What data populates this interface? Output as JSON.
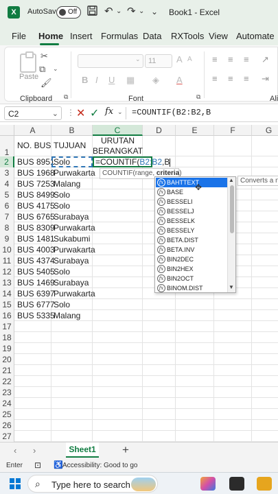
{
  "titlebar": {
    "autosave_label": "AutoSave",
    "autosave_state": "Off",
    "title": "Book1 - Excel"
  },
  "menu": {
    "tabs": [
      "File",
      "Home",
      "Insert",
      "Formulas",
      "Data",
      "RXTools",
      "View",
      "Automate"
    ],
    "active": "Home"
  },
  "ribbon": {
    "paste_label": "Paste",
    "font_size": "11",
    "groups": {
      "clipboard": "Clipboard",
      "font": "Font",
      "alignment": "Ali"
    }
  },
  "formula_bar": {
    "name_box": "C2",
    "content": "=COUNTIF(B2:B2,B"
  },
  "grid": {
    "columns": [
      "A",
      "B",
      "C",
      "D",
      "E",
      "F",
      "G"
    ],
    "selected_column": "C",
    "selected_row": 2,
    "rows": [
      "1",
      "2",
      "3",
      "4",
      "5",
      "6",
      "7",
      "8",
      "9",
      "10",
      "11",
      "12",
      "13",
      "14",
      "15",
      "16",
      "17",
      "18",
      "19",
      "20",
      "21",
      "22",
      "23",
      "24",
      "25",
      "26",
      "27"
    ],
    "header": {
      "a": "NO. BUS",
      "b": "TUJUAN",
      "c_line1": "URUTAN",
      "c_line2": "BERANGKAT"
    },
    "data": [
      [
        "BUS 8951",
        "Solo"
      ],
      [
        "BUS 1968",
        "Purwakarta"
      ],
      [
        "BUS 7253",
        "Malang"
      ],
      [
        "BUS 8499",
        "Solo"
      ],
      [
        "BUS 4175",
        "Solo"
      ],
      [
        "BUS 6765",
        "Surabaya"
      ],
      [
        "BUS 8309",
        "Purwakarta"
      ],
      [
        "BUS 1481",
        "Sukabumi"
      ],
      [
        "BUS 4003",
        "Purwakarta"
      ],
      [
        "BUS 4374",
        "Surabaya"
      ],
      [
        "BUS 5405",
        "Solo"
      ],
      [
        "BUS 1469",
        "Surabaya"
      ],
      [
        "BUS 6397",
        "Purwakarta"
      ],
      [
        "BUS 6777",
        "Solo"
      ],
      [
        "BUS 5335",
        "Malang"
      ]
    ],
    "editing": {
      "prefix": "=COUNTIF(",
      "ref": "B2:B2",
      "suffix": ",B"
    }
  },
  "tooltip": {
    "prefix": "COUNTIF(range, ",
    "bold": "criteria",
    "suffix": ")"
  },
  "autocomplete": {
    "items": [
      "BAHTTEXT",
      "BASE",
      "BESSELI",
      "BESSELJ",
      "BESSELK",
      "BESSELY",
      "BETA.DIST",
      "BETA.INV",
      "BIN2DEC",
      "BIN2HEX",
      "BIN2OCT",
      "BINOM.DIST"
    ],
    "selected_index": 0,
    "description": "Converts a n"
  },
  "sheets": {
    "tabs": [
      "Sheet1"
    ],
    "active": "Sheet1"
  },
  "status": {
    "mode": "Enter",
    "accessibility": "Accessibility: Good to go"
  },
  "taskbar": {
    "search_placeholder": "Type here to search"
  }
}
